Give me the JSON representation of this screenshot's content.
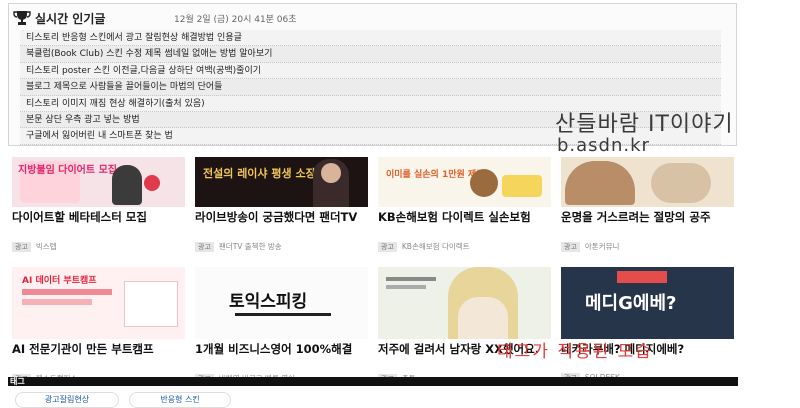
{
  "popular": {
    "title": "실시간 인기글",
    "timestamp": "12월 2일 (금) 20시 41분 06초",
    "items": [
      "티스토리 반응형 스킨에서 광고 잘림현상 해결방법 인용글",
      "북클럽(Book Club) 스킨 수정 제목 썸네일 없애는 방법 알아보기",
      "티스토리 poster 스킨 이전글,다음글 상하단 여백(공백)줄이기",
      "블로그 제목으로 사람들을 끌어들이는 마법의 단어들",
      "티스토리 이미지 깨짐 현상 해결하기(출처 있음)",
      "본문 상단 우측 광고 넣는 방법",
      "구글에서 잃어버린 내 스마트폰 찾는 법"
    ]
  },
  "watermark": {
    "line1": "산들바람 IT이야기",
    "line2": "b.asdn.kr"
  },
  "ad_badge": "광고",
  "ads": [
    {
      "title": "다이어트할 베타테스터 모집",
      "source": "빅스텝",
      "thumb_text": "지방불임 다이어트 모집"
    },
    {
      "title": "라이브방송이 궁금했다면 팬더TV",
      "source": "팬더TV 출첵한 방송",
      "thumb_text": "전설의 레이샤 평생 소장?"
    },
    {
      "title": "KB손해보험 다이렉트 실손보험",
      "source": "KB손해보험 다이렉트",
      "thumb_text": "이미를 실손의 1만원 제공!"
    },
    {
      "title": "운명을 거스르려는 절망의 공주",
      "source": "아톤커뮤니",
      "thumb_text": ""
    },
    {
      "title": "AI 전문기관이 만든 부트캠프",
      "source": "패스트캠퍼스",
      "thumb_text": "AI 데이터 부트캠프"
    },
    {
      "title": "1개월 비즈니스영어 100%해결",
      "source": "바빠영 바로고 빠른 영어",
      "thumb_text": "토익스피킹"
    },
    {
      "title": "저주에 걸려서 남자랑 XX했어요.",
      "source": "쥬튼",
      "thumb_text": ""
    },
    {
      "title": "네카라쿠배? 메디지에베?",
      "source": "SOLDESK",
      "thumb_text": "메디G에베?"
    }
  ],
  "overlay_text": "태그가 적용된 모습",
  "tags": {
    "label": "태그",
    "items": [
      "광고잘림현상",
      "반응형 스킨"
    ]
  },
  "colors": {
    "overlay": "#e83a3a",
    "tag_link": "#1a55a8"
  }
}
